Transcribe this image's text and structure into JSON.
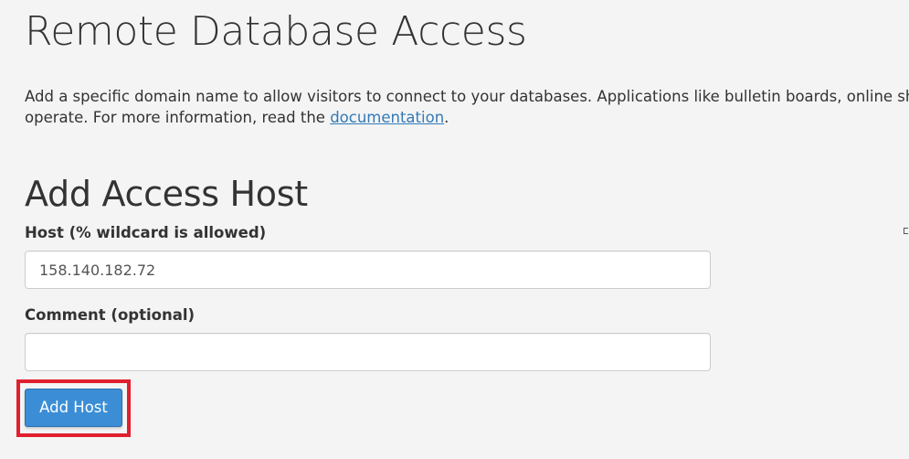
{
  "page": {
    "title": "Remote Database Access",
    "intro_line1": "Add a specific domain name to allow visitors to connect to your databases. Applications like bulletin boards, online sho",
    "intro_line2_prefix": "operate. For more information, read the ",
    "intro_link": "documentation",
    "intro_line2_suffix": "."
  },
  "form": {
    "section_title": "Add Access Host",
    "host_label": "Host (% wildcard is allowed)",
    "host_value": "158.140.182.72",
    "comment_label": "Comment (optional)",
    "comment_value": "",
    "submit_label": "Add Host"
  },
  "colors": {
    "link": "#337ab7",
    "primary_button": "#3b8ed6",
    "highlight": "#e0202e",
    "background": "#f4f4f4"
  }
}
